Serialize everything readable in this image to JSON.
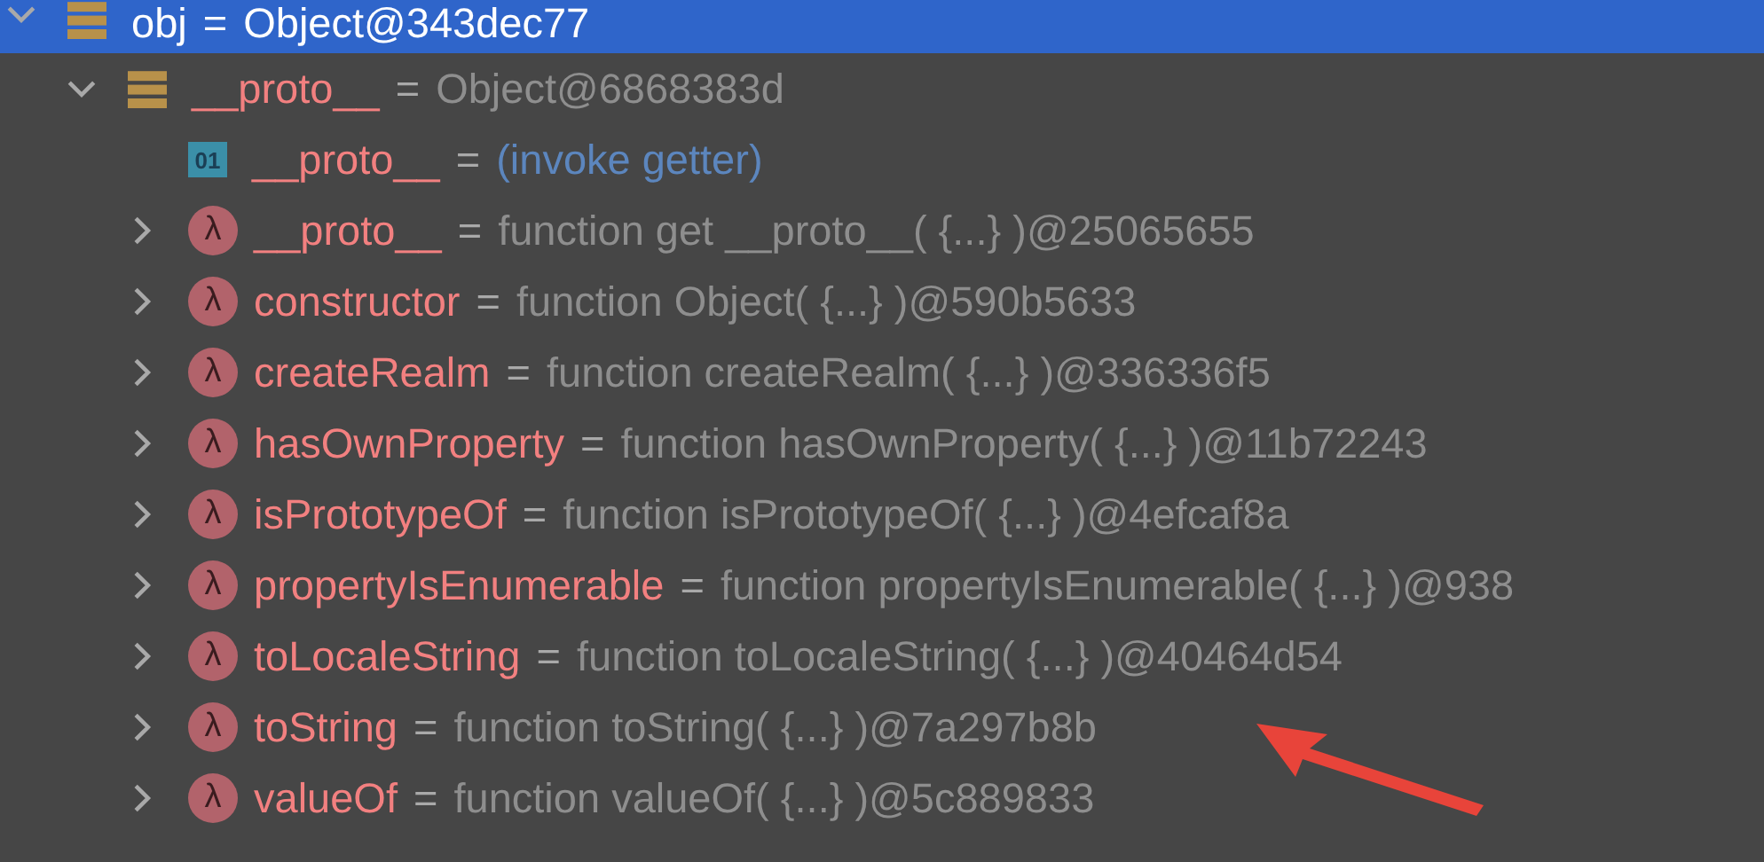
{
  "tree": [
    {
      "name": "obj",
      "eq": "=",
      "value": "Object@343dec77",
      "kind": "object",
      "expanded": true,
      "selected": true,
      "children": [
        {
          "name": "__proto__",
          "eq": "=",
          "value": "Object@6868383d",
          "kind": "object",
          "expanded": true,
          "selected": false,
          "children": [
            {
              "name": "__proto__",
              "eq": "=",
              "value": "(invoke getter)",
              "kind": "getter",
              "badge": "01",
              "selected": false
            },
            {
              "name": "__proto__",
              "eq": "=",
              "value": "function get __proto__( {...} )@25065655",
              "kind": "function",
              "badge": "λ",
              "expanded": false,
              "selected": false
            },
            {
              "name": "constructor",
              "eq": "=",
              "value": "function Object( {...} )@590b5633",
              "kind": "function",
              "badge": "λ",
              "expanded": false,
              "selected": false
            },
            {
              "name": "createRealm",
              "eq": "=",
              "value": "function createRealm( {...} )@336336f5",
              "kind": "function",
              "badge": "λ",
              "expanded": false,
              "selected": false
            },
            {
              "name": "hasOwnProperty",
              "eq": "=",
              "value": "function hasOwnProperty( {...} )@11b72243",
              "kind": "function",
              "badge": "λ",
              "expanded": false,
              "selected": false
            },
            {
              "name": "isPrototypeOf",
              "eq": "=",
              "value": "function isPrototypeOf( {...} )@4efcaf8a",
              "kind": "function",
              "badge": "λ",
              "expanded": false,
              "selected": false
            },
            {
              "name": "propertyIsEnumerable",
              "eq": "=",
              "value": "function propertyIsEnumerable( {...} )@938",
              "kind": "function",
              "badge": "λ",
              "expanded": false,
              "selected": false
            },
            {
              "name": "toLocaleString",
              "eq": "=",
              "value": "function toLocaleString( {...} )@40464d54",
              "kind": "function",
              "badge": "λ",
              "expanded": false,
              "selected": false
            },
            {
              "name": "toString",
              "eq": "=",
              "value": "function toString( {...} )@7a297b8b",
              "kind": "function",
              "badge": "λ",
              "expanded": false,
              "selected": false
            },
            {
              "name": "valueOf",
              "eq": "=",
              "value": "function valueOf( {...} )@5c889833",
              "kind": "function",
              "badge": "λ",
              "expanded": false,
              "selected": false
            }
          ]
        }
      ]
    }
  ]
}
